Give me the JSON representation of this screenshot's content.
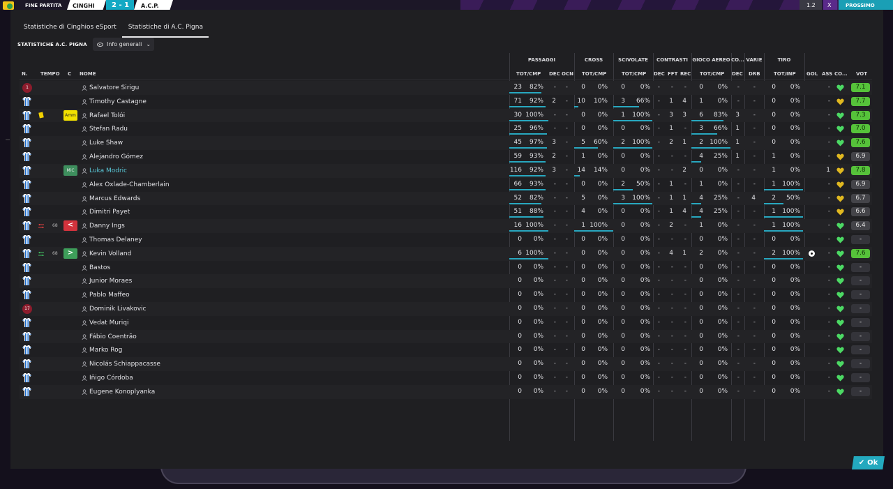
{
  "scoreboard": {
    "status": "FINE PARTITA",
    "home": "CINGHI",
    "score": "2 - 1",
    "away": "A.C.P.",
    "speed": "1.2",
    "close": "X",
    "resume": "PROSSIMO"
  },
  "tabs": [
    {
      "label": "Statistiche di Cinghios eSport"
    },
    {
      "label": "Statistiche di A.C. Pigna"
    }
  ],
  "section_title": "STATISTICHE A.C. PIGNA",
  "view_dropdown": "Info generali",
  "groups": [
    "PASSAGGI",
    "CROSS",
    "SCIVOLATE",
    "CONTRASTI",
    "GIOCO AEREO",
    "CO...",
    "VARIE",
    "TIRO"
  ],
  "headers": {
    "num": "N.",
    "time": "TEMPO",
    "c": "C",
    "name": "NOME",
    "pass_tc": "TOT/CMP",
    "pass_dec": "DEC",
    "pass_ocn": "OCN",
    "cross_tc": "TOT/CMP",
    "tack_tc": "TOT/CMP",
    "cont_dec": "DEC",
    "cont_fft": "FFT",
    "cont_rec": "REC",
    "air_tc": "TOT/CMP",
    "co_dec": "DEC",
    "var_drb": "DRB",
    "shot_ti": "TOT/INP",
    "gol": "GOL",
    "ass": "ASS",
    "co": "CO...",
    "vot": "VOT"
  },
  "players": [
    {
      "gk": "1",
      "name": "Salvatore Sirigu",
      "pt": "23",
      "pp": "82%",
      "pd": "-",
      "po": "-",
      "ct": "0",
      "cp": "0%",
      "tt": "0",
      "tp": "0%",
      "kd": "-",
      "kf": "-",
      "kr": "-",
      "at": "0",
      "ap": "0%",
      "cd": "-",
      "dr": "-",
      "st": "0",
      "sp": "0%",
      "ass": "-",
      "heart": "g",
      "vot": "7.1",
      "vc": "g",
      "pb": 0.82,
      "cb": 0,
      "tb": 0,
      "ab": 0,
      "sb": 0
    },
    {
      "name": "Timothy Castagne",
      "pt": "71",
      "pp": "92%",
      "pd": "2",
      "po": "-",
      "ct": "10",
      "cp": "10%",
      "tt": "3",
      "tp": "66%",
      "kd": "-",
      "kf": "1",
      "kr": "4",
      "at": "1",
      "ap": "0%",
      "cd": "-",
      "dr": "-",
      "st": "0",
      "sp": "0%",
      "ass": "-",
      "heart": "y",
      "vot": "7.7",
      "vc": "g",
      "pb": 0.92,
      "cb": 0.1,
      "tb": 0.66,
      "ab": 0,
      "sb": 0
    },
    {
      "card": "yellow",
      "badge": "Amm",
      "name": "Rafael Tolói",
      "pt": "30",
      "pp": "100%",
      "pd": "-",
      "po": "-",
      "ct": "0",
      "cp": "0%",
      "tt": "1",
      "tp": "100%",
      "kd": "-",
      "kf": "3",
      "kr": "3",
      "at": "6",
      "ap": "83%",
      "cd": "3",
      "dr": "-",
      "st": "0",
      "sp": "0%",
      "ass": "-",
      "heart": "g",
      "vot": "7.3",
      "vc": "g",
      "pb": 1,
      "cb": 0,
      "tb": 1,
      "ab": 0.83,
      "sb": 0
    },
    {
      "name": "Stefan Radu",
      "pt": "25",
      "pp": "96%",
      "pd": "-",
      "po": "-",
      "ct": "0",
      "cp": "0%",
      "tt": "0",
      "tp": "0%",
      "kd": "-",
      "kf": "1",
      "kr": "-",
      "at": "3",
      "ap": "66%",
      "cd": "1",
      "dr": "-",
      "st": "0",
      "sp": "0%",
      "ass": "-",
      "heart": "g",
      "vot": "7.0",
      "vc": "g",
      "pb": 0.96,
      "cb": 0,
      "tb": 0,
      "ab": 0.66,
      "sb": 0
    },
    {
      "name": "Luke Shaw",
      "pt": "45",
      "pp": "97%",
      "pd": "3",
      "po": "-",
      "ct": "5",
      "cp": "60%",
      "tt": "2",
      "tp": "100%",
      "kd": "-",
      "kf": "2",
      "kr": "1",
      "at": "2",
      "ap": "100%",
      "cd": "1",
      "dr": "-",
      "st": "0",
      "sp": "0%",
      "ass": "-",
      "heart": "g",
      "vot": "7.6",
      "vc": "g",
      "pb": 0.97,
      "cb": 0.6,
      "tb": 1,
      "ab": 1,
      "sb": 0
    },
    {
      "name": "Alejandro Gómez",
      "pt": "59",
      "pp": "93%",
      "pd": "2",
      "po": "-",
      "ct": "1",
      "cp": "0%",
      "tt": "0",
      "tp": "0%",
      "kd": "-",
      "kf": "-",
      "kr": "-",
      "at": "4",
      "ap": "25%",
      "cd": "1",
      "dr": "-",
      "st": "1",
      "sp": "0%",
      "ass": "-",
      "heart": "y",
      "vot": "6.9",
      "vc": "y",
      "pb": 0.93,
      "cb": 0,
      "tb": 0,
      "ab": 0.25,
      "sb": 0
    },
    {
      "badge": "MiC",
      "hl": true,
      "name": "Luka Modric",
      "pt": "116",
      "pp": "92%",
      "pd": "3",
      "po": "-",
      "ct": "14",
      "cp": "14%",
      "tt": "0",
      "tp": "0%",
      "kd": "-",
      "kf": "-",
      "kr": "2",
      "at": "0",
      "ap": "0%",
      "cd": "-",
      "dr": "-",
      "st": "1",
      "sp": "0%",
      "ass": "1",
      "heart": "y",
      "vot": "7.8",
      "vc": "g",
      "pb": 0.92,
      "cb": 0.14,
      "tb": 0,
      "ab": 0,
      "sb": 0
    },
    {
      "name": "Alex Oxlade-Chamberlain",
      "pt": "66",
      "pp": "93%",
      "pd": "-",
      "po": "-",
      "ct": "0",
      "cp": "0%",
      "tt": "2",
      "tp": "50%",
      "kd": "-",
      "kf": "1",
      "kr": "-",
      "at": "1",
      "ap": "0%",
      "cd": "-",
      "dr": "-",
      "st": "1",
      "sp": "100%",
      "ass": "-",
      "heart": "y",
      "vot": "6.9",
      "vc": "y",
      "pb": 0.93,
      "cb": 0,
      "tb": 0.5,
      "ab": 0,
      "sb": 1
    },
    {
      "name": "Marcus Edwards",
      "pt": "52",
      "pp": "82%",
      "pd": "-",
      "po": "-",
      "ct": "5",
      "cp": "0%",
      "tt": "3",
      "tp": "100%",
      "kd": "-",
      "kf": "1",
      "kr": "1",
      "at": "4",
      "ap": "25%",
      "cd": "-",
      "dr": "4",
      "st": "2",
      "sp": "50%",
      "ass": "-",
      "heart": "y",
      "vot": "6.7",
      "vc": "y",
      "pb": 0.82,
      "cb": 0,
      "tb": 1,
      "ab": 0.25,
      "sb": 0.5
    },
    {
      "name": "Dimitri Payet",
      "pt": "51",
      "pp": "88%",
      "pd": "-",
      "po": "-",
      "ct": "4",
      "cp": "0%",
      "tt": "0",
      "tp": "0%",
      "kd": "-",
      "kf": "1",
      "kr": "4",
      "at": "4",
      "ap": "25%",
      "cd": "-",
      "dr": "-",
      "st": "1",
      "sp": "100%",
      "ass": "-",
      "heart": "y",
      "vot": "6.6",
      "vc": "y",
      "pb": 0.88,
      "cb": 0,
      "tb": 0,
      "ab": 0.25,
      "sb": 1
    },
    {
      "sub": "off",
      "minute": "68",
      "badge": "<",
      "name": "Danny Ings",
      "pt": "16",
      "pp": "100%",
      "pd": "-",
      "po": "-",
      "ct": "1",
      "cp": "100%",
      "tt": "0",
      "tp": "0%",
      "kd": "-",
      "kf": "2",
      "kr": "-",
      "at": "1",
      "ap": "0%",
      "cd": "-",
      "dr": "-",
      "st": "1",
      "sp": "100%",
      "ass": "-",
      "heart": "g",
      "vot": "6.4",
      "vc": "y",
      "pb": 1,
      "cb": 1,
      "tb": 0,
      "ab": 0,
      "sb": 1
    },
    {
      "name": "Thomas Delaney",
      "pt": "0",
      "pp": "0%",
      "pd": "-",
      "po": "-",
      "ct": "0",
      "cp": "0%",
      "tt": "0",
      "tp": "0%",
      "kd": "-",
      "kf": "-",
      "kr": "-",
      "at": "0",
      "ap": "0%",
      "cd": "-",
      "dr": "-",
      "st": "0",
      "sp": "0%",
      "ass": "-",
      "heart": "g",
      "vot": "-",
      "vc": "n",
      "pb": 0,
      "cb": 0,
      "tb": 0,
      "ab": 0,
      "sb": 0
    },
    {
      "sub": "on",
      "minute": "68",
      "badge": ">",
      "name": "Kevin Volland",
      "pt": "6",
      "pp": "100%",
      "pd": "-",
      "po": "-",
      "ct": "0",
      "cp": "0%",
      "tt": "0",
      "tp": "0%",
      "kd": "-",
      "kf": "4",
      "kr": "1",
      "at": "2",
      "ap": "0%",
      "cd": "-",
      "dr": "-",
      "st": "2",
      "sp": "100%",
      "goal": true,
      "ass": "-",
      "heart": "g",
      "vot": "7.6",
      "vc": "g",
      "pb": 1,
      "cb": 0,
      "tb": 0,
      "ab": 0,
      "sb": 1
    },
    {
      "name": "Bastos",
      "pt": "0",
      "pp": "0%",
      "pd": "-",
      "po": "-",
      "ct": "0",
      "cp": "0%",
      "tt": "0",
      "tp": "0%",
      "kd": "-",
      "kf": "-",
      "kr": "-",
      "at": "0",
      "ap": "0%",
      "cd": "-",
      "dr": "-",
      "st": "0",
      "sp": "0%",
      "ass": "-",
      "heart": "g",
      "vot": "-",
      "vc": "n",
      "pb": 0,
      "cb": 0,
      "tb": 0,
      "ab": 0,
      "sb": 0
    },
    {
      "name": "Junior Moraes",
      "pt": "0",
      "pp": "0%",
      "pd": "-",
      "po": "-",
      "ct": "0",
      "cp": "0%",
      "tt": "0",
      "tp": "0%",
      "kd": "-",
      "kf": "-",
      "kr": "-",
      "at": "0",
      "ap": "0%",
      "cd": "-",
      "dr": "-",
      "st": "0",
      "sp": "0%",
      "ass": "-",
      "heart": "g",
      "vot": "-",
      "vc": "n",
      "pb": 0,
      "cb": 0,
      "tb": 0,
      "ab": 0,
      "sb": 0
    },
    {
      "name": "Pablo Maffeo",
      "pt": "0",
      "pp": "0%",
      "pd": "-",
      "po": "-",
      "ct": "0",
      "cp": "0%",
      "tt": "0",
      "tp": "0%",
      "kd": "-",
      "kf": "-",
      "kr": "-",
      "at": "0",
      "ap": "0%",
      "cd": "-",
      "dr": "-",
      "st": "0",
      "sp": "0%",
      "ass": "-",
      "heart": "g",
      "vot": "-",
      "vc": "n",
      "pb": 0,
      "cb": 0,
      "tb": 0,
      "ab": 0,
      "sb": 0
    },
    {
      "gk": "17",
      "name": "Dominik Livakovic",
      "pt": "0",
      "pp": "0%",
      "pd": "-",
      "po": "-",
      "ct": "0",
      "cp": "0%",
      "tt": "0",
      "tp": "0%",
      "kd": "-",
      "kf": "-",
      "kr": "-",
      "at": "0",
      "ap": "0%",
      "cd": "-",
      "dr": "-",
      "st": "0",
      "sp": "0%",
      "ass": "-",
      "heart": "g",
      "vot": "-",
      "vc": "n",
      "pb": 0,
      "cb": 0,
      "tb": 0,
      "ab": 0,
      "sb": 0
    },
    {
      "name": "Vedat Muriqi",
      "pt": "0",
      "pp": "0%",
      "pd": "-",
      "po": "-",
      "ct": "0",
      "cp": "0%",
      "tt": "0",
      "tp": "0%",
      "kd": "-",
      "kf": "-",
      "kr": "-",
      "at": "0",
      "ap": "0%",
      "cd": "-",
      "dr": "-",
      "st": "0",
      "sp": "0%",
      "ass": "-",
      "heart": "g",
      "vot": "-",
      "vc": "n",
      "pb": 0,
      "cb": 0,
      "tb": 0,
      "ab": 0,
      "sb": 0
    },
    {
      "name": "Fábio Coentrão",
      "pt": "0",
      "pp": "0%",
      "pd": "-",
      "po": "-",
      "ct": "0",
      "cp": "0%",
      "tt": "0",
      "tp": "0%",
      "kd": "-",
      "kf": "-",
      "kr": "-",
      "at": "0",
      "ap": "0%",
      "cd": "-",
      "dr": "-",
      "st": "0",
      "sp": "0%",
      "ass": "-",
      "heart": "g",
      "vot": "-",
      "vc": "n",
      "pb": 0,
      "cb": 0,
      "tb": 0,
      "ab": 0,
      "sb": 0
    },
    {
      "name": "Marko Rog",
      "pt": "0",
      "pp": "0%",
      "pd": "-",
      "po": "-",
      "ct": "0",
      "cp": "0%",
      "tt": "0",
      "tp": "0%",
      "kd": "-",
      "kf": "-",
      "kr": "-",
      "at": "0",
      "ap": "0%",
      "cd": "-",
      "dr": "-",
      "st": "0",
      "sp": "0%",
      "ass": "-",
      "heart": "g",
      "vot": "-",
      "vc": "n",
      "pb": 0,
      "cb": 0,
      "tb": 0,
      "ab": 0,
      "sb": 0
    },
    {
      "name": "Nicolás Schiappacasse",
      "pt": "0",
      "pp": "0%",
      "pd": "-",
      "po": "-",
      "ct": "0",
      "cp": "0%",
      "tt": "0",
      "tp": "0%",
      "kd": "-",
      "kf": "-",
      "kr": "-",
      "at": "0",
      "ap": "0%",
      "cd": "-",
      "dr": "-",
      "st": "0",
      "sp": "0%",
      "ass": "-",
      "heart": "g",
      "vot": "-",
      "vc": "n",
      "pb": 0,
      "cb": 0,
      "tb": 0,
      "ab": 0,
      "sb": 0
    },
    {
      "name": "Iñigo Córdoba",
      "pt": "0",
      "pp": "0%",
      "pd": "-",
      "po": "-",
      "ct": "0",
      "cp": "0%",
      "tt": "0",
      "tp": "0%",
      "kd": "-",
      "kf": "-",
      "kr": "-",
      "at": "0",
      "ap": "0%",
      "cd": "-",
      "dr": "-",
      "st": "0",
      "sp": "0%",
      "ass": "-",
      "heart": "g",
      "vot": "-",
      "vc": "n",
      "pb": 0,
      "cb": 0,
      "tb": 0,
      "ab": 0,
      "sb": 0
    },
    {
      "name": "Eugene Konoplyanka",
      "pt": "0",
      "pp": "0%",
      "pd": "-",
      "po": "-",
      "ct": "0",
      "cp": "0%",
      "tt": "0",
      "tp": "0%",
      "kd": "-",
      "kf": "-",
      "kr": "-",
      "at": "0",
      "ap": "0%",
      "cd": "-",
      "dr": "-",
      "st": "0",
      "sp": "0%",
      "ass": "-",
      "heart": "g",
      "vot": "-",
      "vc": "n",
      "pb": 0,
      "cb": 0,
      "tb": 0,
      "ab": 0,
      "sb": 0
    }
  ],
  "ok_label": "Ok",
  "colors": {
    "accent": "#23a9be",
    "rating_good": "#56c23a",
    "heart_green": "#4cd964",
    "heart_yellow": "#e0b820",
    "gk_red": "#8c1c2c"
  }
}
